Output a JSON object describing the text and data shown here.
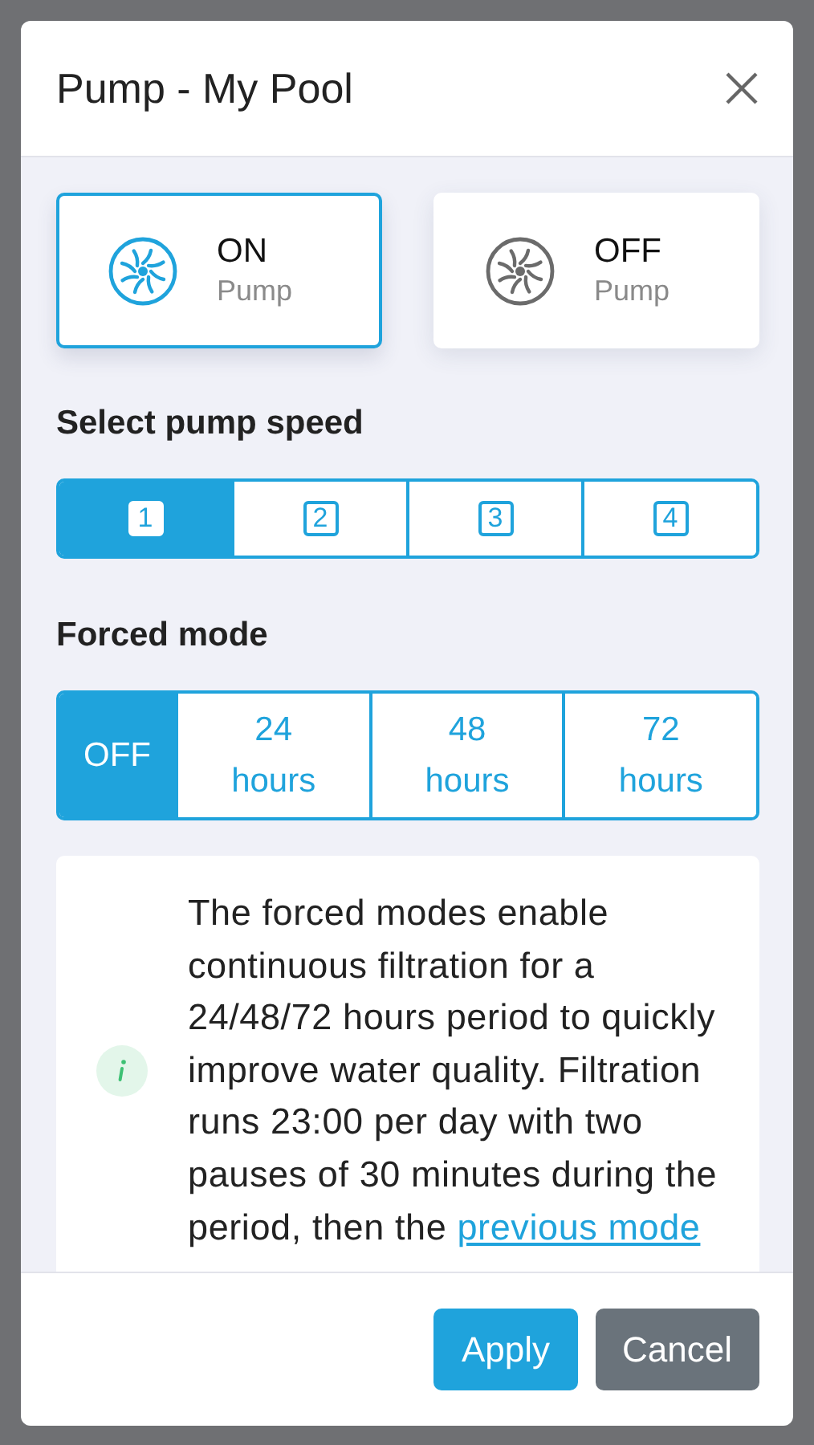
{
  "dialog": {
    "title": "Pump - My Pool"
  },
  "power_options": [
    {
      "label": "ON",
      "sublabel": "Pump",
      "selected": true
    },
    {
      "label": "OFF",
      "sublabel": "Pump",
      "selected": false
    }
  ],
  "speed": {
    "label": "Select pump speed",
    "options": [
      {
        "label": "1",
        "selected": true
      },
      {
        "label": "2",
        "selected": false
      },
      {
        "label": "3",
        "selected": false
      },
      {
        "label": "4",
        "selected": false
      }
    ]
  },
  "forced_mode": {
    "label": "Forced mode",
    "options": [
      {
        "label": "OFF",
        "selected": true
      },
      {
        "label": "24 hours",
        "selected": false
      },
      {
        "label": "48 hours",
        "selected": false
      },
      {
        "label": "72 hours",
        "selected": false
      }
    ]
  },
  "info": {
    "text": "The forced modes enable continuous filtration for a 24/48/72 hours period to quickly improve water quality. Filtration runs 23:00 per day with two pauses of 30 minutes during the period, then the",
    "link": "previous mode"
  },
  "buttons": [
    {
      "label": "Apply",
      "kind": "primary"
    },
    {
      "label": "Cancel",
      "kind": "secondary"
    }
  ]
}
